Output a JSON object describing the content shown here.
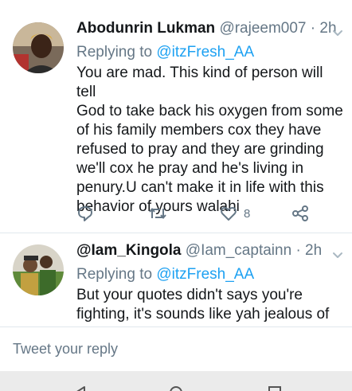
{
  "tweets": [
    {
      "display_name": "Abodunrin Lukman",
      "handle": "@rajeem007",
      "separator": "·",
      "time": "2h",
      "replying_prefix": "Replying to",
      "replying_handle": "@itzFresh_AA",
      "body_lines": [
        "You are mad.  This kind of person will tell",
        "God to take back his oxygen from some",
        "of his family members cox they have",
        "refused to pray and they are grinding",
        "we'll cox he pray and he's living in",
        "penury.U can't make it in life with this",
        "behavior of yours walahi"
      ],
      "like_count": "8"
    },
    {
      "display_name": "@Iam_Kingola",
      "handle": "@Iam_captainn",
      "separator": "·",
      "time": "2h",
      "replying_prefix": "Replying to",
      "replying_handle": "@itzFresh_AA",
      "body_lines": [
        "But your quotes didn't says you're",
        "fighting,  it's sounds like yah jealous of"
      ]
    }
  ],
  "composer": {
    "placeholder": "Tweet your reply"
  },
  "colors": {
    "accent": "#1da1f2",
    "muted": "#657786",
    "text": "#14171a",
    "divider": "#e1e8ed"
  },
  "icons": [
    "chevron-down-icon",
    "reply-icon",
    "retweet-icon",
    "like-icon",
    "share-icon",
    "back-icon",
    "home-icon",
    "recents-icon"
  ]
}
